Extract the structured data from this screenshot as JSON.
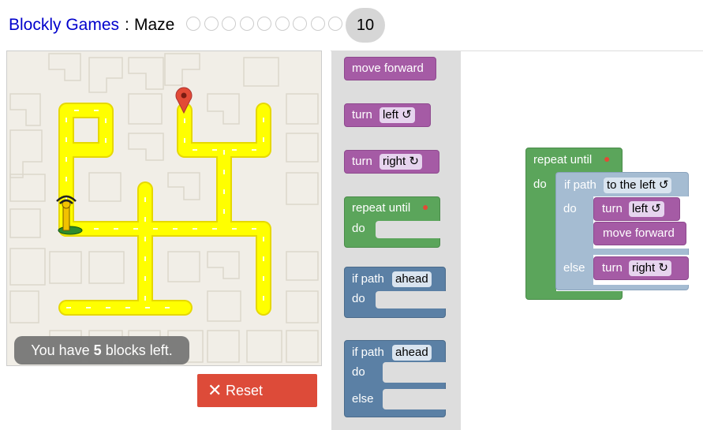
{
  "header": {
    "brand": "Blockly Games",
    "separator": ":",
    "game": "Maze",
    "current_level": "10",
    "levels_total": 10
  },
  "maze": {
    "message_prefix": "You have ",
    "blocks_left": "5",
    "message_suffix": " blocks left."
  },
  "reset_label": "Reset",
  "toolbox": {
    "move_forward": "move forward",
    "turn_left": {
      "label": "turn",
      "value": "left ↺"
    },
    "turn_right": {
      "label": "turn",
      "value": "right ↻"
    },
    "repeat": {
      "label": "repeat until",
      "do": "do"
    },
    "if_path": {
      "label": "if path",
      "value": "ahead",
      "do": "do"
    },
    "if_else": {
      "label": "if path",
      "value": "ahead",
      "do": "do",
      "else": "else"
    }
  },
  "program": {
    "repeat_label": "repeat until",
    "do": "do",
    "if_label": "if path",
    "if_value": "to the left ↺",
    "if_do": "do",
    "turn_label": "turn",
    "turn_left_value": "left ↺",
    "move_forward": "move forward",
    "else": "else",
    "turn_label_2": "turn",
    "turn_right_value": "right ↻"
  },
  "colors": {
    "path": "#ffff00",
    "motion_block": "#a55ba5",
    "loop_block": "#5ba55b",
    "logic_block": "#5b80a5",
    "reset": "#dd4b39",
    "link": "#0000cc"
  }
}
